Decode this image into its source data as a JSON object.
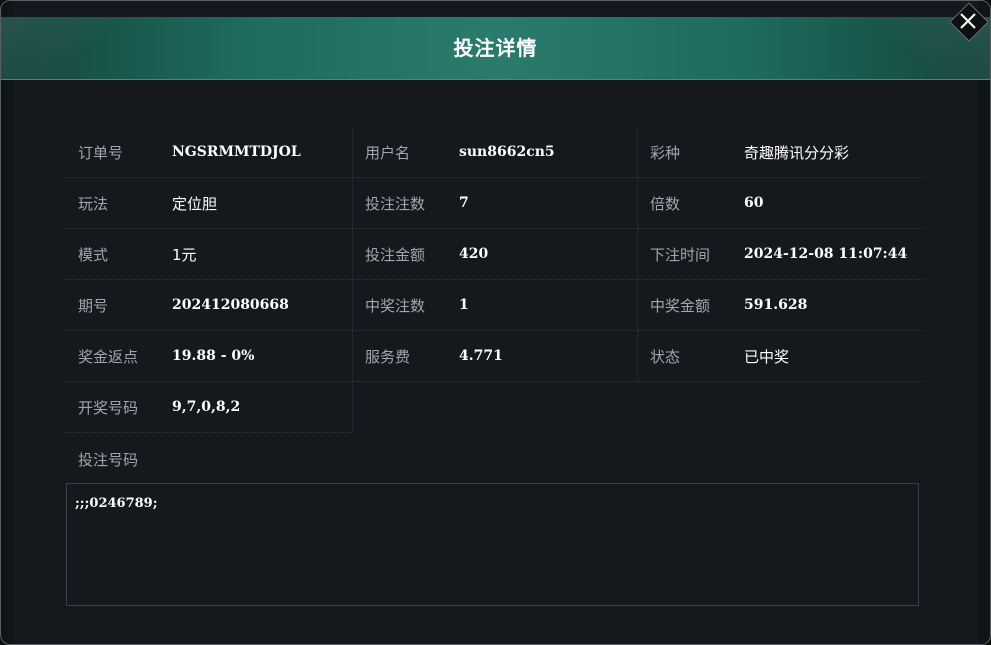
{
  "header": {
    "title": "投注详情"
  },
  "details": {
    "order_no": {
      "label": "订单号",
      "value": "NGSRMMTDJOL"
    },
    "username": {
      "label": "用户名",
      "value": "sun8662cn5"
    },
    "lottery": {
      "label": "彩种",
      "value": "奇趣腾讯分分彩"
    },
    "play": {
      "label": "玩法",
      "value": "定位胆"
    },
    "bet_count": {
      "label": "投注注数",
      "value": "7"
    },
    "multiple": {
      "label": "倍数",
      "value": "60"
    },
    "mode": {
      "label": "模式",
      "value": "1元"
    },
    "bet_amount": {
      "label": "投注金额",
      "value": "420"
    },
    "bet_time": {
      "label": "下注时间",
      "value": "2024-12-08 11:07:44"
    },
    "issue": {
      "label": "期号",
      "value": "202412080668"
    },
    "win_count": {
      "label": "中奖注数",
      "value": "1"
    },
    "win_amount": {
      "label": "中奖金额",
      "value": "591.628"
    },
    "rebate": {
      "label": "奖金返点",
      "value": "19.88 - 0%"
    },
    "service_fee": {
      "label": "服务费",
      "value": "4.771"
    },
    "status": {
      "label": "状态",
      "value": "已中奖"
    },
    "draw_numbers": {
      "label": "开奖号码",
      "value": "9,7,0,8,2"
    }
  },
  "bet_numbers": {
    "label": "投注号码",
    "value": ";;;0246789;"
  },
  "colors": {
    "header_accent": "#2a7b6e",
    "background": "#15191d",
    "label_text": "#a0a6ab",
    "value_text": "#ffffff"
  },
  "icons": {
    "close": "close-icon"
  }
}
